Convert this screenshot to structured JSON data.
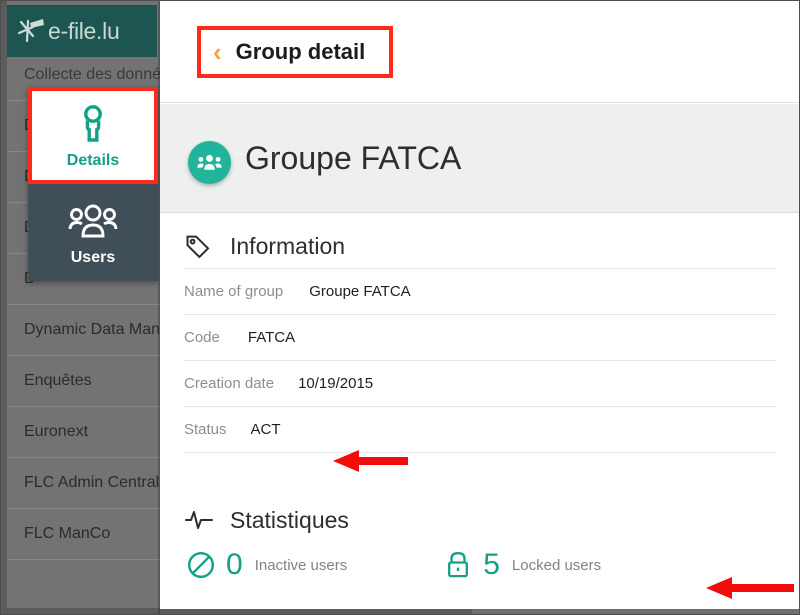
{
  "app": {
    "logo_text": "e-file.lu",
    "logo_icon": "asterisk-star-icon",
    "logo_bg": "#1d5650"
  },
  "background_list": {
    "items": [
      {
        "label": "Collecte des données"
      },
      {
        "label": "D"
      },
      {
        "label": "D"
      },
      {
        "label": "D"
      },
      {
        "label": "D"
      },
      {
        "label": "Dynamic Data Man"
      },
      {
        "label": "Enquêtes"
      },
      {
        "label": "Euronext"
      },
      {
        "label": "FLC Admin Central"
      },
      {
        "label": "FLC ManCo"
      }
    ]
  },
  "tab_rail": {
    "tabs": [
      {
        "label": "Details",
        "icon": "info-pin-icon",
        "active": true
      },
      {
        "label": "Users",
        "icon": "users-group-icon",
        "active": false
      }
    ],
    "highlight_color": "#fc2b1b",
    "active_color": "#14a085",
    "inactive_bg": "#3f4e57"
  },
  "header": {
    "back_icon": "chevron-left-icon",
    "back_icon_color": "#f5a04b",
    "title": "Group detail",
    "highlight_color": "#fc2b1b"
  },
  "group": {
    "avatar_icon": "users-group-icon",
    "avatar_color": "#22b49a",
    "name": "Groupe FATCA"
  },
  "information": {
    "icon": "tag-icon",
    "heading": "Information",
    "rows": [
      {
        "label": "Name of group",
        "value": "Groupe FATCA"
      },
      {
        "label": "Code",
        "value": "FATCA"
      },
      {
        "label": "Creation date",
        "value": "10/19/2015"
      },
      {
        "label": "Status",
        "value": "ACT"
      }
    ]
  },
  "statistics": {
    "icon": "pulse-activity-icon",
    "heading": "Statistiques",
    "items": [
      {
        "icon": "prohibited-circle-icon",
        "count": "0",
        "label": "Inactive users"
      },
      {
        "icon": "lock-icon",
        "count": "5",
        "label": "Locked users"
      }
    ],
    "accent_color": "#14a085"
  },
  "annotations": {
    "arrow_color": "#f40c0c",
    "arrows": [
      {
        "points_at": "Status value ACT"
      },
      {
        "points_at": "Locked users statistic"
      }
    ]
  }
}
